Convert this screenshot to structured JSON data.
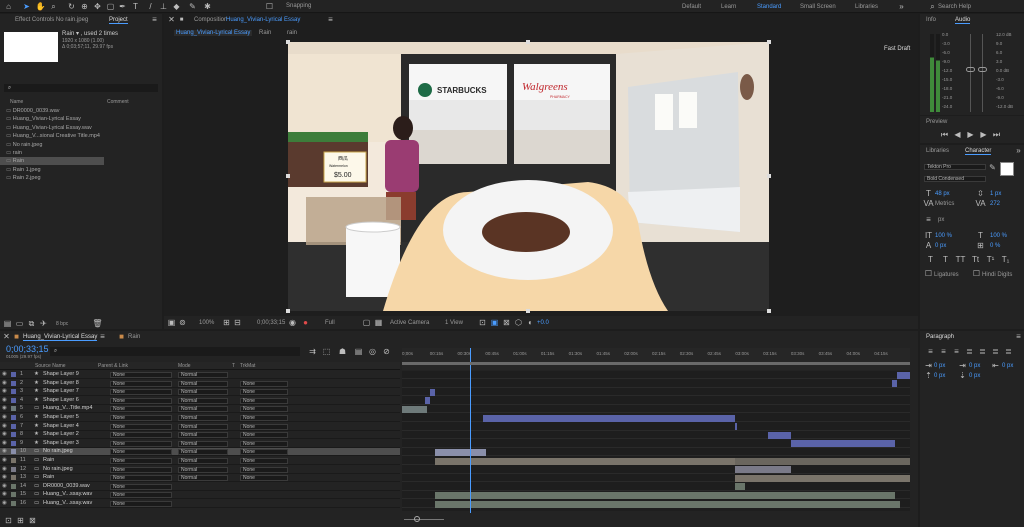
{
  "top": {
    "snapping": "Snapping",
    "workspaces": [
      "Default",
      "Learn",
      "Standard",
      "Small Screen",
      "Libraries"
    ],
    "active_workspace": "Standard",
    "search": "Search Help"
  },
  "project": {
    "tabs": [
      "Effect Controls No rain.jpeg",
      "Project"
    ],
    "selected_name": "Rain ▾ , used 2 times",
    "selected_dims": "1920 x 1080 (1.00)",
    "selected_info": "Δ 0;03;57;11, 29.97 fps",
    "col_name": "Name",
    "col_comment": "Comment",
    "items": [
      "DR0000_0039.wav",
      "Huang_Vivian-Lyrical Essay",
      "Huang_Vivian-Lyrical Essay.wav",
      "Huang_V...sional Creative Title.mp4",
      "No rain.jpeg",
      "rain",
      "Rain",
      "Rain 1.jpeg",
      "Rain 2.jpeg"
    ],
    "bpc": "8 bpc"
  },
  "comp": {
    "title_prefix": "Composition",
    "title": "Huang_Vivian-Lyrical Essay",
    "tabs": [
      "Huang_Vivian-Lyrical Essay",
      "Rain",
      "rain"
    ],
    "fast_draft": "Fast Draft",
    "zoom": "100%",
    "timecode": "0;00;33;15",
    "quality": "Full",
    "camera": "Active Camera",
    "views": "1 View",
    "exposure": "+0.0"
  },
  "scene": {
    "store1": "STARBUCKS",
    "store2": "Walgreens",
    "store2_sub": "PHARMACY",
    "price_top": "西瓜",
    "price_mid": "Watermelon",
    "price": "$5.00"
  },
  "timeline": {
    "tabs": [
      "Huang_Vivian-Lyrical Essay",
      "Rain"
    ],
    "timecode": "0;00;33;15",
    "frames": "01005 (29.97 fps)",
    "cols": [
      "Source Name",
      "Parent & Link",
      "Mode",
      "T",
      "TrkMat"
    ],
    "ruler": [
      "0;00s",
      "00:15s",
      "00:30s",
      "00:45s",
      "01:00s",
      "01:15s",
      "01:30s",
      "01:45s",
      "02:00s",
      "02:15s",
      "02:30s",
      "02:45s",
      "03:00s",
      "03:15s",
      "03:30s",
      "03:45s",
      "04:00s",
      "04:15s"
    ],
    "layers": [
      {
        "n": "1",
        "name": "Shape Layer 9",
        "parent": "None",
        "mode": "Normal",
        "trk": "",
        "c": "#5a63a8"
      },
      {
        "n": "2",
        "name": "Shape Layer 8",
        "parent": "None",
        "mode": "Normal",
        "trk": "None",
        "c": "#5a63a8"
      },
      {
        "n": "3",
        "name": "Shape Layer 7",
        "parent": "None",
        "mode": "Normal",
        "trk": "None",
        "c": "#5a63a8"
      },
      {
        "n": "4",
        "name": "Shape Layer 6",
        "parent": "None",
        "mode": "Normal",
        "trk": "None",
        "c": "#5a63a8"
      },
      {
        "n": "5",
        "name": "Huang_V...Title.mp4",
        "parent": "None",
        "mode": "Normal",
        "trk": "None",
        "c": "#6e7a7a"
      },
      {
        "n": "6",
        "name": "Shape Layer 5",
        "parent": "None",
        "mode": "Normal",
        "trk": "None",
        "c": "#5a63a8"
      },
      {
        "n": "7",
        "name": "Shape Layer 4",
        "parent": "None",
        "mode": "Normal",
        "trk": "None",
        "c": "#5a63a8"
      },
      {
        "n": "8",
        "name": "Shape Layer 2",
        "parent": "None",
        "mode": "Normal",
        "trk": "None",
        "c": "#5a63a8"
      },
      {
        "n": "9",
        "name": "Shape Layer 3",
        "parent": "None",
        "mode": "Normal",
        "trk": "None",
        "c": "#5a63a8"
      },
      {
        "n": "10",
        "name": "No rain.jpeg",
        "parent": "None",
        "mode": "Normal",
        "trk": "None",
        "c": "#8a8faa"
      },
      {
        "n": "11",
        "name": "Rain",
        "parent": "None",
        "mode": "Normal",
        "trk": "None",
        "c": "#7a746a"
      },
      {
        "n": "12",
        "name": "No rain.jpeg",
        "parent": "None",
        "mode": "Normal",
        "trk": "None",
        "c": "#7a7a88"
      },
      {
        "n": "13",
        "name": "Rain",
        "parent": "None",
        "mode": "Normal",
        "trk": "None",
        "c": "#7a746a"
      },
      {
        "n": "14",
        "name": "DR0000_0039.wav",
        "parent": "None",
        "mode": "",
        "trk": "",
        "c": "#6a766a"
      },
      {
        "n": "15",
        "name": "Huang_V...ssay.wav",
        "parent": "None",
        "mode": "",
        "trk": "",
        "c": "#6a766a"
      },
      {
        "n": "16",
        "name": "Huang_V...ssay.wav",
        "parent": "None",
        "mode": "",
        "trk": "",
        "c": "#6a766a"
      }
    ],
    "clips": [
      [
        [
          0.975,
          1.0,
          "#5a63a8"
        ]
      ],
      [
        [
          0.965,
          0.975,
          "#5a63a8"
        ]
      ],
      [
        [
          0.055,
          0.065,
          "#5a63a8"
        ]
      ],
      [
        [
          0.045,
          0.055,
          "#5a63a8"
        ]
      ],
      [
        [
          0.0,
          0.05,
          "#6e7a7a"
        ]
      ],
      [
        [
          0.16,
          0.655,
          "#5a63a8"
        ]
      ],
      [
        [
          0.655,
          0.66,
          "#5a63a8"
        ]
      ],
      [
        [
          0.72,
          0.765,
          "#5a63a8"
        ]
      ],
      [
        [
          0.765,
          0.97,
          "#5a63a8"
        ]
      ],
      [
        [
          0.065,
          0.165,
          "#8a8faa"
        ]
      ],
      [
        [
          0.065,
          0.655,
          "#7a746a"
        ],
        [
          0.655,
          1.0,
          "#6a665e"
        ]
      ],
      [
        [
          0.655,
          0.765,
          "#7a7a88"
        ]
      ],
      [
        [
          0.655,
          1.0,
          "#7a746a"
        ]
      ],
      [
        [
          0.655,
          0.675,
          "#6a766a"
        ]
      ],
      [
        [
          0.065,
          0.97,
          "#6a766a"
        ]
      ],
      [
        [
          0.065,
          0.98,
          "#6a766a"
        ]
      ]
    ]
  },
  "info": {
    "tabs": [
      "Info",
      "Audio"
    ],
    "db_right": [
      "12.0 dB",
      "9.0",
      "6.0",
      "3.0",
      "0.0 dB",
      "-3.0",
      "-6.0",
      "-9.0",
      "-12.0 dB"
    ],
    "db_left": [
      "0.0",
      "-3.0",
      "-6.0",
      "-9.0",
      "-12.0",
      "-15.0",
      "-18.0",
      "-21.0",
      "-24.0"
    ]
  },
  "preview": {
    "title": "Preview"
  },
  "character": {
    "tabs": [
      "Libraries",
      "Character"
    ],
    "font": "Tekton Pro",
    "style": "Bold Condensed",
    "size": "48 px",
    "leading": "1 px",
    "kerning": "Metrics",
    "tracking": "272",
    "unit": "px",
    "vscale": "100 %",
    "hscale": "100 %",
    "baseline": "0 px",
    "tsume": "0 %",
    "ligatures": "Ligatures",
    "hindi": "Hindi Digits",
    "styles": [
      "T",
      "T",
      "TT",
      "Tt",
      "T¹",
      "T₁"
    ]
  },
  "paragraph": {
    "title": "Paragraph",
    "indent": [
      "0 px",
      "0 px",
      "0 px",
      "0 px",
      "0 px"
    ]
  }
}
